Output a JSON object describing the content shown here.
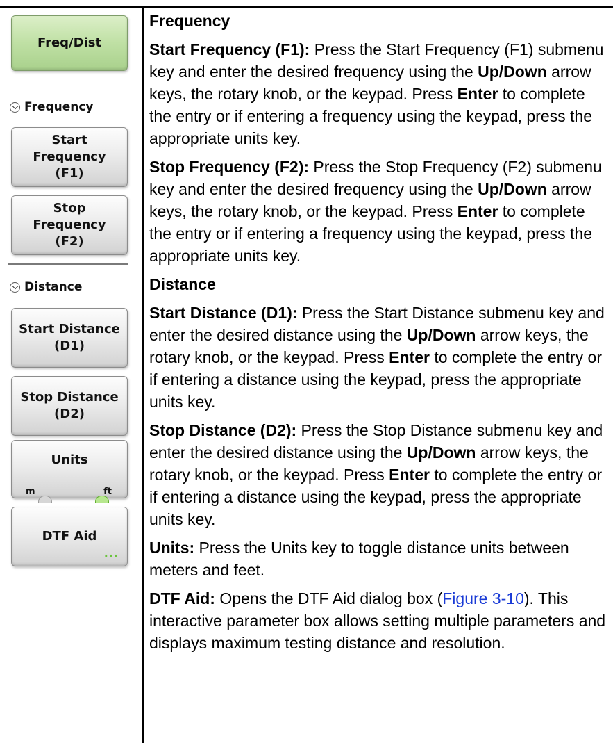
{
  "menu": {
    "title_button": "Freq/Dist",
    "sections": {
      "frequency": "Frequency",
      "distance": "Distance"
    },
    "buttons": {
      "start_frequency": "Start\nFrequency\n(F1)",
      "stop_frequency": "Stop\nFrequency\n(F2)",
      "start_distance": "Start Distance\n(D1)",
      "stop_distance": "Stop Distance\n(D2)",
      "units": "Units",
      "units_m": "m",
      "units_ft": "ft",
      "units_selected": "ft",
      "dtf_aid": "DTF Aid",
      "dtf_aid_more": "..."
    }
  },
  "content": {
    "frequency_heading": "Frequency",
    "start_freq": {
      "label": "Start Frequency (F1):",
      "t1": " Press the Start Frequency (F1) submenu key and enter the desired frequency using the ",
      "b1": "Up/Down",
      "t2": " arrow keys, the rotary knob, or the keypad. Press ",
      "b2": "Enter",
      "t3": " to complete the entry or if entering a frequency using the keypad, press the appropriate units key."
    },
    "stop_freq": {
      "label": "Stop Frequency (F2):",
      "t1": " Press the Stop Frequency (F2) submenu key and enter the desired frequency using the ",
      "b1": "Up/Down",
      "t2": " arrow keys, the rotary knob, or the keypad. Press ",
      "b2": "Enter",
      "t3": " to complete the entry or if entering a frequency using the keypad, press the appropriate units key."
    },
    "distance_heading": "Distance",
    "start_dist": {
      "label": "Start Distance (D1):",
      "t1": " Press the Start Distance submenu key and enter the desired distance using the ",
      "b1": "Up/Down",
      "t2": " arrow keys, the rotary knob, or the keypad. Press ",
      "b2": "Enter",
      "t3": " to complete the entry or if entering a distance using the keypad, press the appropriate units key."
    },
    "stop_dist": {
      "label": "Stop Distance (D2):",
      "t1": " Press the Stop Distance submenu key and enter the desired distance using the ",
      "b1": "Up/Down",
      "t2": " arrow keys, the rotary knob, or the keypad. Press ",
      "b2": "Enter",
      "t3": " to complete the entry or if entering a distance using the keypad, press the appropriate units key."
    },
    "units": {
      "label": "Units:",
      "t1": " Press the Units key to toggle distance units between meters and feet."
    },
    "dtf_aid": {
      "label": "DTF Aid:",
      "t1": " Opens the DTF Aid dialog box (",
      "link": "Figure 3-10",
      "t2": "). This interactive parameter box allows setting multiple parameters and displays maximum testing distance and resolution."
    }
  }
}
